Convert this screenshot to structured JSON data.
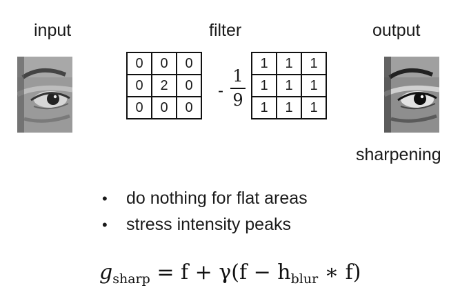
{
  "labels": {
    "input": "input",
    "filter": "filter",
    "output": "output",
    "sharpening": "sharpening"
  },
  "filter": {
    "left_matrix": [
      [
        "0",
        "0",
        "0"
      ],
      [
        "0",
        "2",
        "0"
      ],
      [
        "0",
        "0",
        "0"
      ]
    ],
    "minus": "-",
    "fraction_numerator": "1",
    "fraction_denominator": "9",
    "right_matrix": [
      [
        "1",
        "1",
        "1"
      ],
      [
        "1",
        "1",
        "1"
      ],
      [
        "1",
        "1",
        "1"
      ]
    ]
  },
  "bullets": [
    "do nothing for flat areas",
    "stress intensity peaks"
  ],
  "formula": {
    "lhs_symbol": "g",
    "lhs_subscript": "sharp",
    "rhs_text": "= f + γ(f − h",
    "blur_subscript": "blur",
    "rhs_tail": "∗ f)"
  }
}
